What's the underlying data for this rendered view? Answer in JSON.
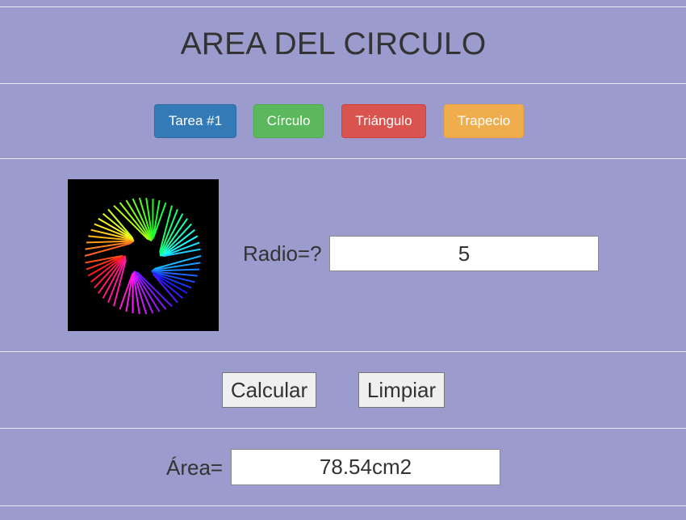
{
  "header": {
    "title": "AREA DEL CIRCULO"
  },
  "nav": {
    "items": [
      {
        "label": "Tarea #1",
        "color": "#337ab7"
      },
      {
        "label": "Círculo",
        "color": "#5cb85c"
      },
      {
        "label": "Triángulo",
        "color": "#d9534f"
      },
      {
        "label": "Trapecio",
        "color": "#f0ad4e"
      }
    ]
  },
  "form": {
    "radius_label": "Radio=?",
    "radius_value": "5",
    "calculate_label": "Calcular",
    "clear_label": "Limpiar",
    "area_label": "Área=",
    "area_value": "78.54cm2"
  },
  "illustration": {
    "icon": "color-spiral-icon"
  },
  "colors": {
    "background": "#9b9bcd",
    "divider": "#e6e6f4"
  }
}
